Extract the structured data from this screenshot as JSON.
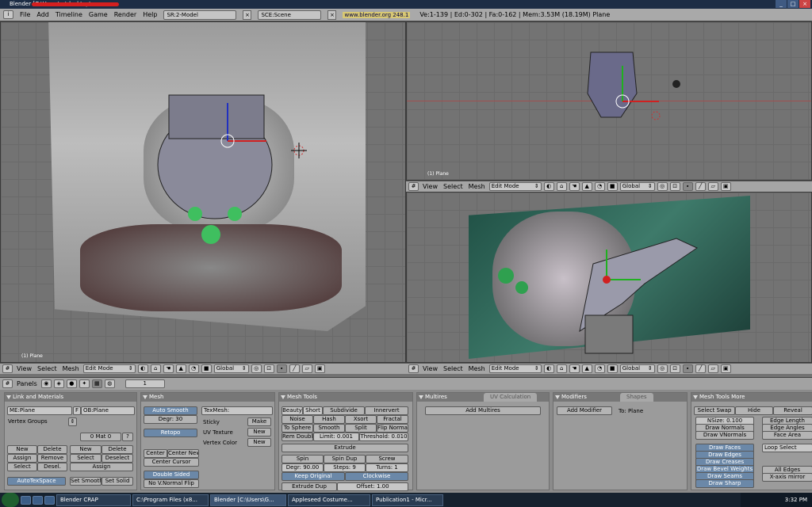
{
  "title_bar": {
    "title": "Blender [C:\\Users\\...\\desktop\\"
  },
  "menu": {
    "items": [
      "File",
      "Add",
      "Timeline",
      "Game",
      "Render",
      "Help"
    ],
    "screen": "SR:2-Model",
    "scene": "SCE:Scene",
    "url": "www.blender.org 248.1",
    "stats": "Ve:1-139 | Ed:0-302 | Fa:0-162 | Mem:3.53M (18.19M) Plane"
  },
  "viewports": {
    "object_label": "(1) Plane",
    "menu": [
      "View",
      "Select",
      "Mesh"
    ],
    "mode": "Edit Mode",
    "orientation": "Global"
  },
  "buttons_header": {
    "label": "Panels",
    "frame": "1"
  },
  "link_materials": {
    "tab": "Link and Materials",
    "me_field": "ME:Plane",
    "f_label": "F",
    "ob_field": "OB:Plane",
    "vertex_groups": "Vertex Groups",
    "mat": "0 Mat 0",
    "q": "?",
    "new": "New",
    "delete": "Delete",
    "assign": "Assign",
    "remove": "Remove",
    "select": "Select",
    "desel": "Desel.",
    "deselect": "Deselect",
    "autotexspace": "AutoTexSpace",
    "set_smooth": "Set Smooth",
    "set_solid": "Set Solid"
  },
  "mesh": {
    "tab": "Mesh",
    "auto_smooth": "Auto Smooth",
    "degr": "Degr: 30",
    "retopo": "Retopo",
    "center": "Center",
    "center_new": "Center New",
    "center_cursor": "Center Cursor",
    "double_sided": "Double Sided",
    "no_v_normal_flip": "No V.Normal Flip",
    "texmesh": "TexMesh:",
    "sticky": "Sticky",
    "make": "Make",
    "uv_texture": "UV Texture",
    "vertex_color": "Vertex Color",
    "new": "New"
  },
  "mesh_tools": {
    "tab": "Mesh Tools",
    "r1": [
      "Beauty",
      "Short",
      "Subdivide",
      "Innervert"
    ],
    "r2": [
      "Noise",
      "Hash",
      "Xsort",
      "Fractal"
    ],
    "r3": [
      "To Sphere",
      "Smooth",
      "Split",
      "Flip Normal"
    ],
    "r4": [
      "Rem Doubl",
      "Limit: 0.001",
      "Threshold: 0.010"
    ],
    "extrude": "Extrude",
    "r5": [
      "Spin",
      "Spin Dup",
      "Screw"
    ],
    "r6": [
      "Degr: 90.00",
      "Steps: 9",
      "Turns: 1"
    ],
    "keep_original": "Keep Original",
    "clockwise": "Clockwise",
    "extrude_dup": "Extrude Dup",
    "offset": "Offset: 1.00"
  },
  "multires": {
    "tab": "Multires",
    "tab2": "UV Calculation",
    "add": "Add Multires"
  },
  "modifiers": {
    "tab": "Modifiers",
    "tab2": "Shapes",
    "add": "Add Modifier",
    "to": "To: Plane"
  },
  "mesh_tools_more": {
    "tab": "Mesh Tools More",
    "r1": [
      "Select Swap",
      "Hide",
      "Reveal"
    ],
    "nsize": "NSize: 0.100",
    "draw_normals": "Draw Normals",
    "draw_vnormals": "Draw VNormals",
    "edge_length": "Edge Length",
    "edge_angles": "Edge Angles",
    "face_area": "Face Area",
    "draw_faces": "Draw Faces",
    "draw_edges": "Draw Edges",
    "draw_creases": "Draw Creases",
    "draw_bevel": "Draw Bevel Weights",
    "draw_seams": "Draw Seams",
    "draw_sharp": "Draw Sharp",
    "loop_select": "Loop Select",
    "all_edges": "All Edges",
    "x_axis": "X-axis mirror"
  },
  "taskbar": {
    "items": [
      "Blender CRAP",
      "C:\\Program Files (x8...",
      "Blender [C:\\Users\\G...",
      "Appleseed Costume...",
      "Publication1 - Micr..."
    ],
    "time": "3:32 PM"
  },
  "colors": {
    "accent": "#6b88a8",
    "panel": "#9b9b9b",
    "viewport": "#737373"
  }
}
